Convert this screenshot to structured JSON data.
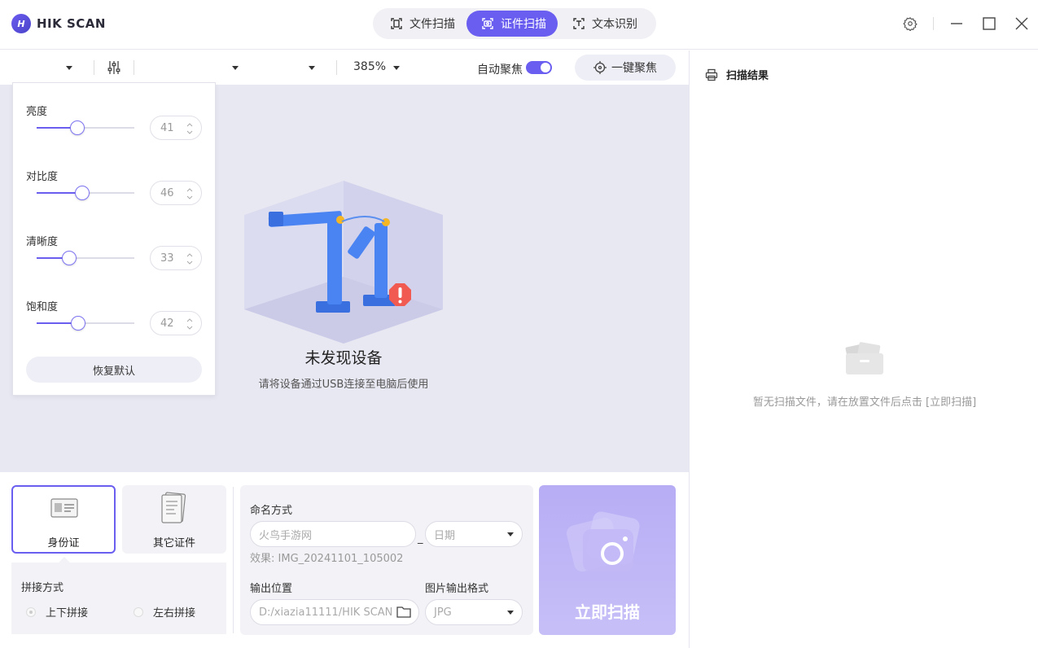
{
  "app": {
    "brand_mark": "H",
    "brand_name": "HIK SCAN"
  },
  "mode_tabs": [
    {
      "label": "文件扫描",
      "icon": "document-scan-icon",
      "active": false
    },
    {
      "label": "证件扫描",
      "icon": "id-scan-icon",
      "active": true
    },
    {
      "label": "文本识别",
      "icon": "text-recognition-icon",
      "active": false
    }
  ],
  "window_controls": [
    "gear-icon",
    "minimize-icon",
    "maximize-icon",
    "close-icon"
  ],
  "toolbar": {
    "zoom": "385%",
    "auto_focus_label": "自动聚焦",
    "auto_focus_on": true,
    "one_click_focus_label": "一键聚焦"
  },
  "adjustments": {
    "items": [
      {
        "label": "亮度",
        "value": "41"
      },
      {
        "label": "对比度",
        "value": "46"
      },
      {
        "label": "清晰度",
        "value": "33"
      },
      {
        "label": "饱和度",
        "value": "42"
      }
    ],
    "reset_label": "恢复默认"
  },
  "preview": {
    "title": "未发现设备",
    "desc": "请将设备通过USB连接至电脑后使用"
  },
  "id_types": [
    {
      "label": "身份证",
      "active": true
    },
    {
      "label": "其它证件",
      "active": false
    }
  ],
  "stitch": {
    "title": "拼接方式",
    "options": [
      {
        "label": "上下拼接",
        "selected": true
      },
      {
        "label": "左右拼接",
        "selected": false
      }
    ]
  },
  "naming": {
    "title": "命名方式",
    "name_placeholder": "火鸟手游网",
    "separator": "_",
    "date_select": "日期",
    "effect": "效果: IMG_20241101_105002",
    "output_label": "输出位置",
    "output_path": "D:/xiazia11111/HIK SCAN",
    "format_label": "图片输出格式",
    "format_value": "JPG"
  },
  "scan_button": {
    "label": "立即扫描"
  },
  "results": {
    "title": "扫描结果",
    "empty_text": "暂无扫描文件，请在放置文件后点击 [立即扫描]"
  },
  "colors": {
    "accent": "#6a5ef0",
    "panel_bg": "#f3f3f7",
    "preview_bg": "#e8e8f2"
  }
}
